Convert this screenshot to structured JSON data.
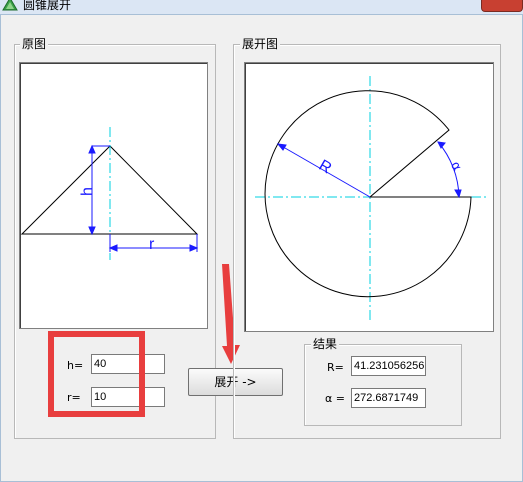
{
  "window": {
    "title": "圆锥展开"
  },
  "original_group": {
    "label": "原图",
    "h_label": "h",
    "r_label": "r"
  },
  "unfold_group": {
    "label": "展开图",
    "R_label": "R",
    "alpha_label": "α"
  },
  "inputs": {
    "h_label": "h=",
    "h_value": "40",
    "r_label": "r=",
    "r_value": "10"
  },
  "button": {
    "label": "展开 ->"
  },
  "results": {
    "label": "结果",
    "R_label": "R=",
    "R_value": "41.2310562561766",
    "alpha_label": "α =",
    "alpha_value": "272.6871749"
  },
  "colors": {
    "accent_line": "#00d0e0",
    "dimension": "#1a1aff",
    "highlight": "#e83e3e",
    "arrow": "#e83e3e"
  }
}
